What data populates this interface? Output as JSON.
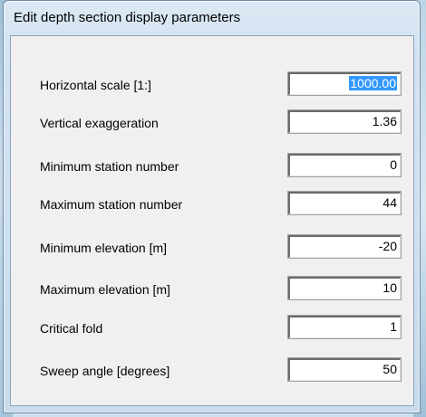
{
  "dialog": {
    "title": "Edit depth section display parameters"
  },
  "fields": [
    {
      "label": "Horizontal scale [1:]",
      "value": "1000.00",
      "selected": true
    },
    {
      "label": "Vertical exaggeration",
      "value": "1.36"
    },
    {
      "label": "Minimum station number",
      "value": "0"
    },
    {
      "label": "Maximum station number",
      "value": "44"
    },
    {
      "label": "Minimum elevation [m]",
      "value": "-20"
    },
    {
      "label": "Maximum elevation [m]",
      "value": "10"
    },
    {
      "label": "Critical fold",
      "value": "1"
    },
    {
      "label": "Sweep angle [degrees]",
      "value": "50"
    }
  ],
  "colors": {
    "selection_highlight": "#3399ff",
    "dialog_background": "#f0f0f0"
  }
}
